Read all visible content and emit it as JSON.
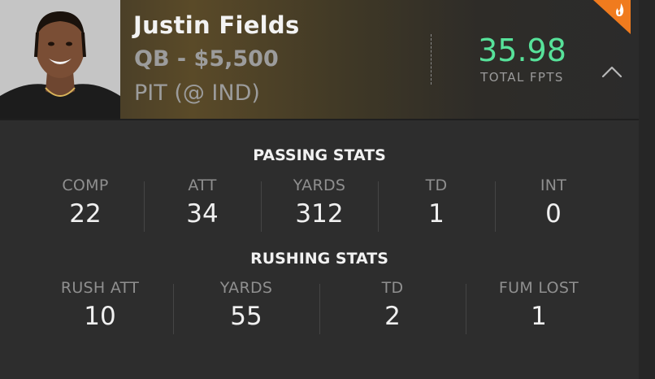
{
  "player": {
    "name": "Justin Fields",
    "position_salary": "QB - $5,500",
    "matchup": "PIT (@ IND)"
  },
  "fantasy": {
    "points": "35.98",
    "points_label": "TOTAL FPTS"
  },
  "passing": {
    "title": "PASSING STATS",
    "stats": [
      {
        "label": "COMP",
        "value": "22"
      },
      {
        "label": "ATT",
        "value": "34"
      },
      {
        "label": "YARDS",
        "value": "312"
      },
      {
        "label": "TD",
        "value": "1"
      },
      {
        "label": "INT",
        "value": "0"
      }
    ]
  },
  "rushing": {
    "title": "RUSHING STATS",
    "stats": [
      {
        "label": "RUSH ATT",
        "value": "10"
      },
      {
        "label": "YARDS",
        "value": "55"
      },
      {
        "label": "TD",
        "value": "2"
      },
      {
        "label": "FUM LOST",
        "value": "1"
      }
    ]
  },
  "icons": {
    "collapse": "chevron-up-icon",
    "hot": "flame-icon"
  },
  "colors": {
    "points": "#57e29a",
    "hot_badge": "#f07b1e"
  }
}
